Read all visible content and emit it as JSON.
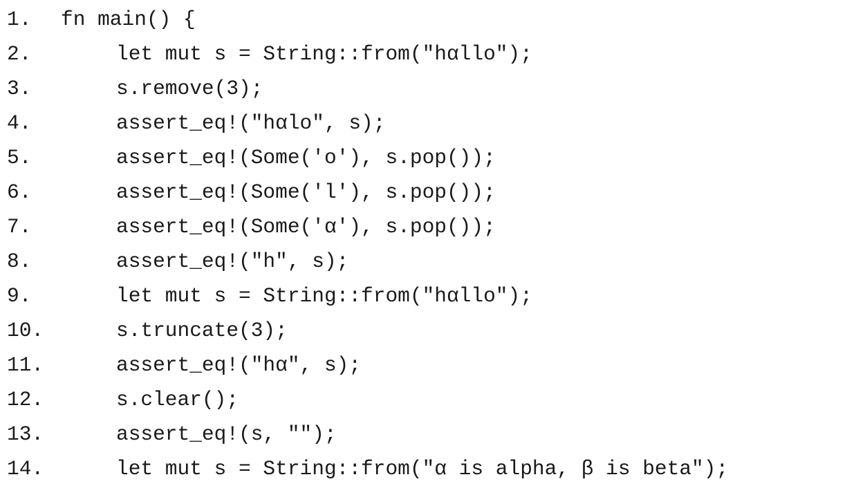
{
  "code": {
    "lines": [
      {
        "number": "1.",
        "text": "fn main() {",
        "indent": 0
      },
      {
        "number": "2.",
        "text": "let mut s = String::from(\"hαllo\");",
        "indent": 1
      },
      {
        "number": "3.",
        "text": "s.remove(3);",
        "indent": 1
      },
      {
        "number": "4.",
        "text": "assert_eq!(\"hαlo\", s);",
        "indent": 1
      },
      {
        "number": "5.",
        "text": "assert_eq!(Some('o'), s.pop());",
        "indent": 1
      },
      {
        "number": "6.",
        "text": "assert_eq!(Some('l'), s.pop());",
        "indent": 1
      },
      {
        "number": "7.",
        "text": "assert_eq!(Some('α'), s.pop());",
        "indent": 1
      },
      {
        "number": "8.",
        "text": "assert_eq!(\"h\", s);",
        "indent": 1
      },
      {
        "number": "9.",
        "text": "let mut s = String::from(\"hαllo\");",
        "indent": 1
      },
      {
        "number": "10.",
        "text": "s.truncate(3);",
        "indent": 1
      },
      {
        "number": "11.",
        "text": "assert_eq!(\"hα\", s);",
        "indent": 1
      },
      {
        "number": "12.",
        "text": "s.clear();",
        "indent": 1
      },
      {
        "number": "13.",
        "text": "assert_eq!(s, \"\");",
        "indent": 1
      },
      {
        "number": "14.",
        "text": "let mut s = String::from(\"α is alpha, β is beta\");",
        "indent": 1
      }
    ]
  }
}
